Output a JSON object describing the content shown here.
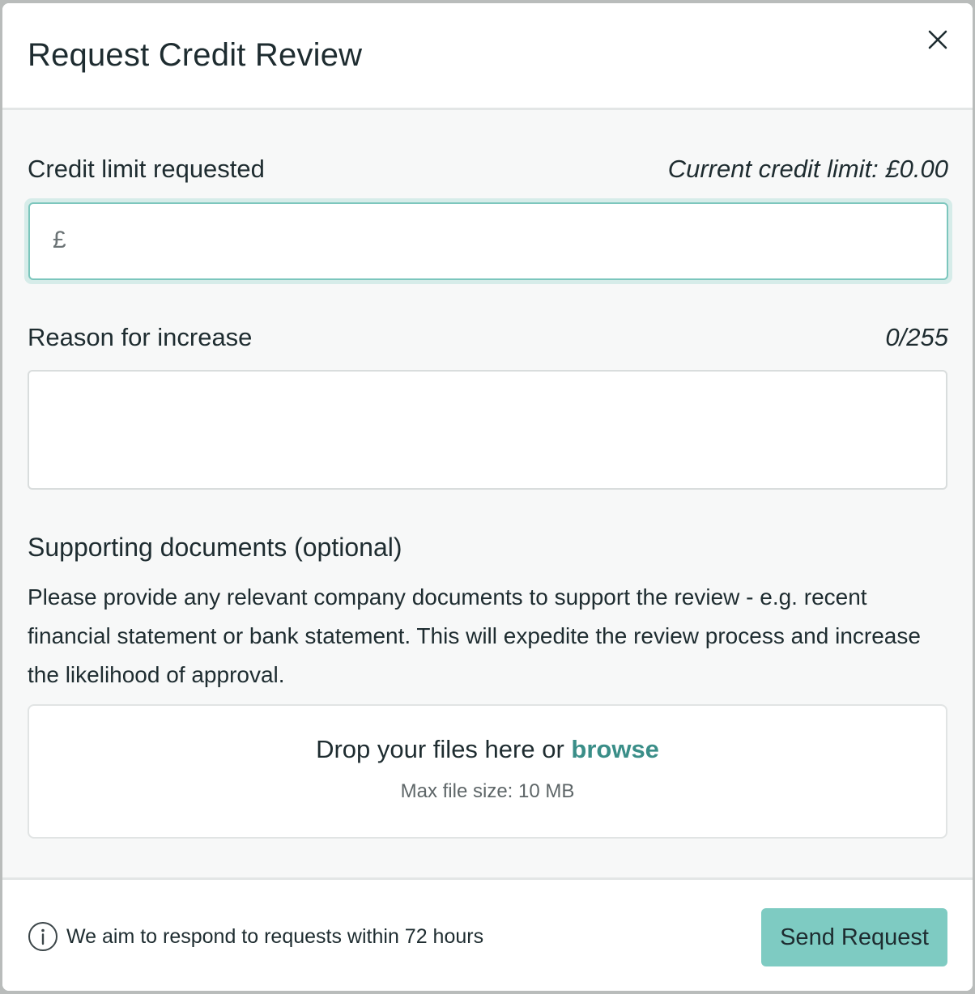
{
  "modal": {
    "title": "Request Credit Review"
  },
  "credit_limit": {
    "label": "Credit limit requested",
    "current_limit_text": "Current credit limit: £0.00",
    "currency_symbol": "£",
    "value": ""
  },
  "reason": {
    "label": "Reason for increase",
    "char_count": "0/255",
    "value": ""
  },
  "documents": {
    "heading": "Supporting documents (optional)",
    "description": "Please provide any relevant company documents to support the review - e.g. recent financial statement or bank statement. This will expedite the review process and increase the likelihood of approval.",
    "dropzone": {
      "prompt": "Drop your files here or",
      "browse_label": "browse",
      "max_size": "Max file size: 10 MB"
    }
  },
  "footer": {
    "note": "We aim to respond to requests within 72 hours",
    "send_label": "Send Request"
  },
  "colors": {
    "accent": "#7ecbc2",
    "link": "#3a8e88",
    "input_focus_border": "#7cc6bd"
  },
  "icons": {
    "close": "close-icon",
    "info": "info-icon"
  }
}
